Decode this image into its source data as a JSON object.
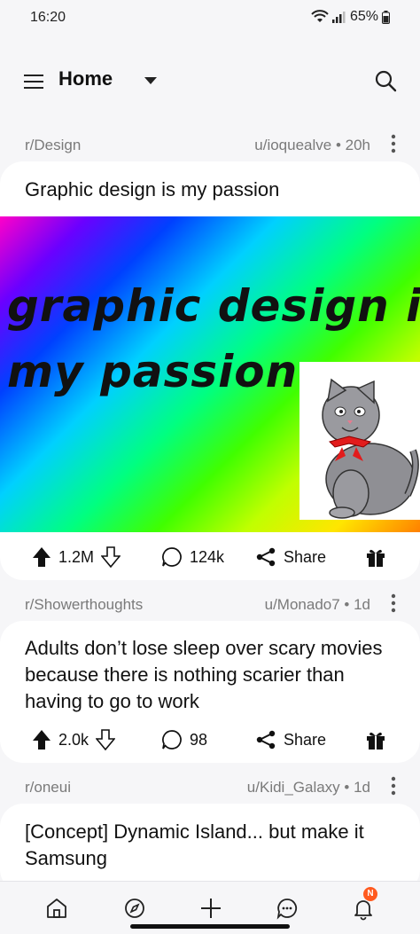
{
  "status_bar": {
    "time": "16:20",
    "battery": "65%"
  },
  "header": {
    "title": "Home"
  },
  "posts": [
    {
      "subreddit": "r/Design",
      "user_time": "u/ioquealve • 20h",
      "title": "Graphic design is my passion",
      "image_text": [
        "graphic design is",
        "my passion."
      ],
      "upvotes": "1.2M",
      "comments": "124k",
      "share_label": "Share"
    },
    {
      "subreddit": "r/Showerthoughts",
      "user_time": "u/Monado7 • 1d",
      "title": "Adults don’t lose sleep over scary movies because there is nothing scarier than having to go to work",
      "upvotes": "2.0k",
      "comments": "98",
      "share_label": "Share"
    },
    {
      "subreddit": "r/oneui",
      "user_time": "u/Kidi_Galaxy • 1d",
      "title": "[Concept] Dynamic Island... but make it Samsung"
    }
  ],
  "bottom_nav": {
    "items": [
      "home-icon",
      "explore-icon",
      "create-icon",
      "chat-icon",
      "notifications-icon"
    ],
    "notification_badge": "N"
  },
  "colors": {
    "background": "#f6f6f8",
    "card": "#ffffff",
    "meta_text": "#7a7a7a",
    "badge": "#ff5a1f"
  }
}
